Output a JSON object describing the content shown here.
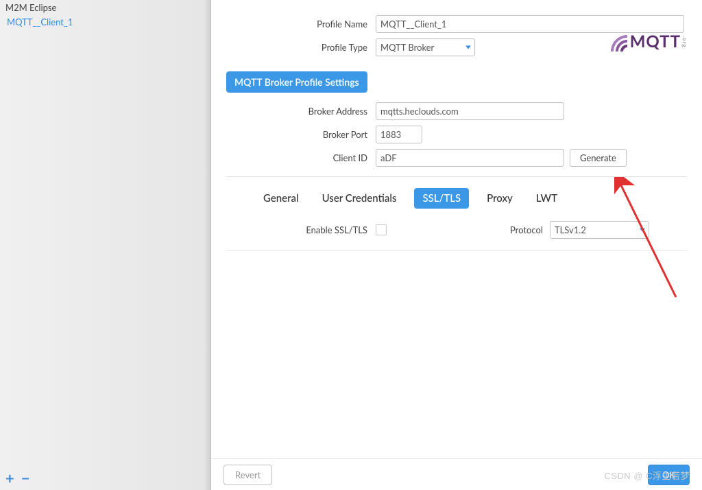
{
  "sidebar": {
    "header": "M2M Eclipse",
    "items": [
      "MQTT__Client_1"
    ],
    "add_icon": "+",
    "remove_icon": "−"
  },
  "profile": {
    "name_label": "Profile Name",
    "name_value": "MQTT__Client_1",
    "type_label": "Profile Type",
    "type_value": "MQTT Broker"
  },
  "logo": {
    "text": "MQTT",
    "suffix": ".org"
  },
  "section": {
    "title": "MQTT Broker Profile Settings"
  },
  "broker": {
    "addr_label": "Broker Address",
    "addr_value": "mqtts.heclouds.com",
    "port_label": "Broker Port",
    "port_value": "1883",
    "clientid_label": "Client ID",
    "clientid_value": "aDF",
    "generate_label": "Generate"
  },
  "tabs": {
    "general": "General",
    "user_credentials": "User Credentials",
    "ssl_tls": "SSL/TLS",
    "proxy": "Proxy",
    "lwt": "LWT"
  },
  "ssl": {
    "enable_label": "Enable SSL/TLS",
    "protocol_label": "Protocol",
    "protocol_value": "TLSv1.2"
  },
  "footer": {
    "revert": "Revert",
    "ok": "OK"
  },
  "watermark": "CSDN @ C浮生若梦"
}
